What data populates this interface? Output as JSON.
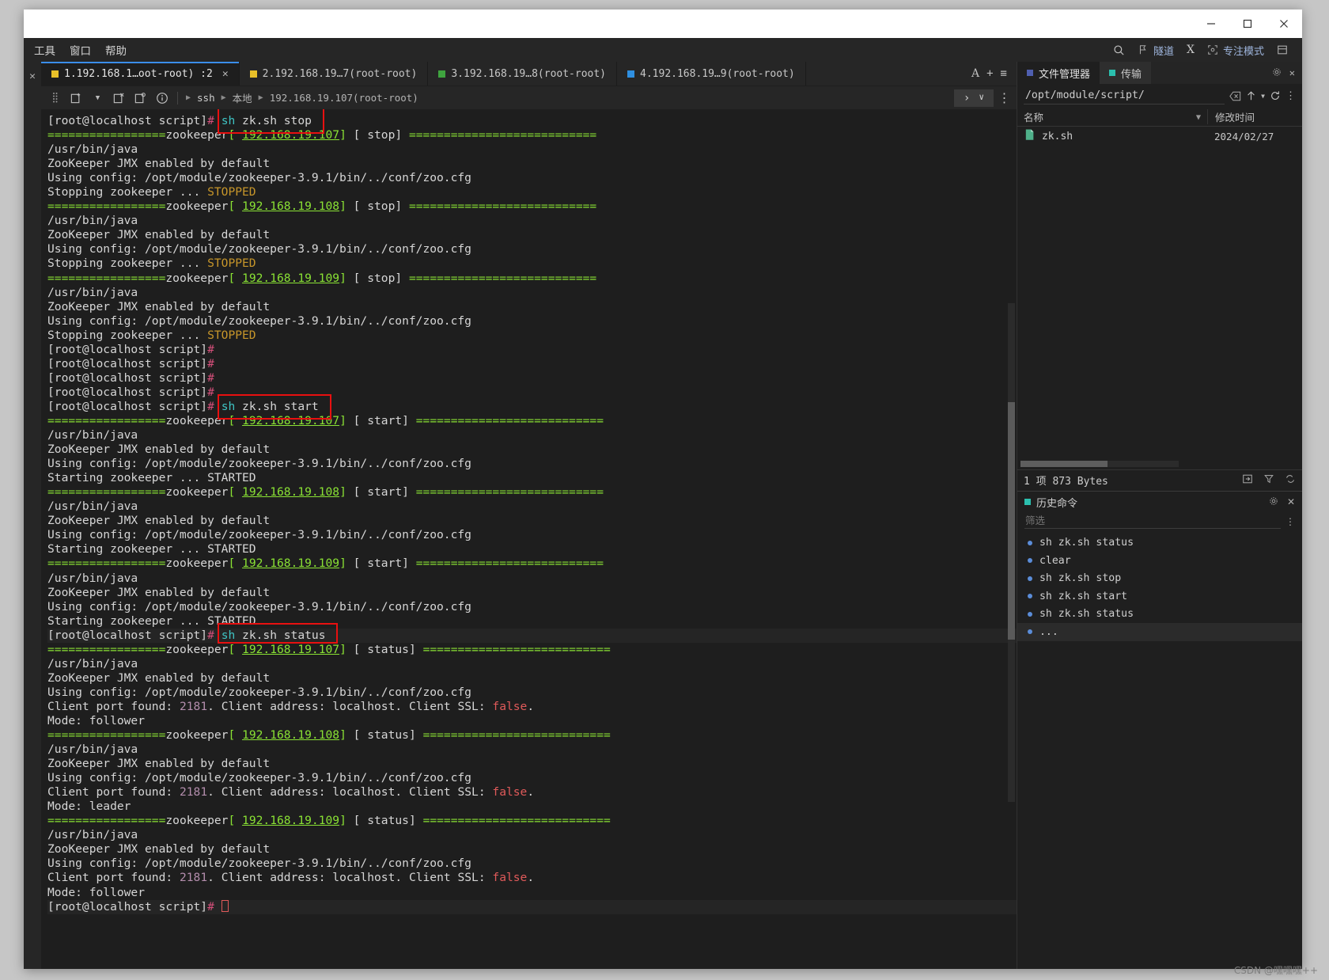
{
  "window": {
    "controls": {
      "minimize": "—",
      "maximize": "❑",
      "close": "✕"
    }
  },
  "menubar": {
    "items": [
      "工具",
      "窗口",
      "帮助"
    ],
    "right": [
      {
        "icon": "search-icon",
        "label": ""
      },
      {
        "icon": "tunnel-icon",
        "label": "隧道"
      },
      {
        "icon": "x-icon",
        "label": "X"
      },
      {
        "icon": "focus-icon",
        "label": "专注模式"
      },
      {
        "icon": "layout-icon",
        "label": ""
      }
    ]
  },
  "tabs": [
    {
      "label": "1.192.168.1…oot-root) :2",
      "color": "#e8c029",
      "active": true,
      "closable": true
    },
    {
      "label": "2.192.168.19…7(root-root)",
      "color": "#e8c029",
      "active": false,
      "closable": false
    },
    {
      "label": "3.192.168.19…8(root-root)",
      "color": "#3fa43f",
      "active": false,
      "closable": false
    },
    {
      "label": "4.192.168.19…9(root-root)",
      "color": "#2f8fe0",
      "active": false,
      "closable": false
    }
  ],
  "tabbar_right": [
    "A",
    "+",
    "≡"
  ],
  "pathbar": {
    "crumbs": [
      "ssh",
      "本地",
      "192.168.19.107(root-root)"
    ],
    "chevron": "›",
    "caret": "∨",
    "more": "⋮"
  },
  "terminal": {
    "prompt": "[root@localhost script]",
    "commands": {
      "stop": "sh zk.sh stop",
      "start": "sh zk.sh start",
      "status": "sh zk.sh status"
    },
    "hosts": [
      "192.168.19.107",
      "192.168.19.108",
      "192.168.19.109"
    ],
    "lines": [
      {
        "t": "prompt-cmd",
        "cmd": "sh zk.sh stop",
        "boxed": true
      },
      {
        "t": "banner",
        "host": "192.168.19.107",
        "action": " stop"
      },
      {
        "t": "plain",
        "s": "/usr/bin/java"
      },
      {
        "t": "plain",
        "s": "ZooKeeper JMX enabled by default"
      },
      {
        "t": "plain",
        "s": "Using config: /opt/module/zookeeper-3.9.1/bin/../conf/zoo.cfg"
      },
      {
        "t": "state",
        "pre": "Stopping zookeeper ... ",
        "word": "STOPPED",
        "cls": "or"
      },
      {
        "t": "banner",
        "host": "192.168.19.108",
        "action": " stop"
      },
      {
        "t": "plain",
        "s": "/usr/bin/java"
      },
      {
        "t": "plain",
        "s": "ZooKeeper JMX enabled by default"
      },
      {
        "t": "plain",
        "s": "Using config: /opt/module/zookeeper-3.9.1/bin/../conf/zoo.cfg"
      },
      {
        "t": "state",
        "pre": "Stopping zookeeper ... ",
        "word": "STOPPED",
        "cls": "or"
      },
      {
        "t": "banner",
        "host": "192.168.19.109",
        "action": " stop"
      },
      {
        "t": "plain",
        "s": "/usr/bin/java"
      },
      {
        "t": "plain",
        "s": "ZooKeeper JMX enabled by default"
      },
      {
        "t": "plain",
        "s": "Using config: /opt/module/zookeeper-3.9.1/bin/../conf/zoo.cfg"
      },
      {
        "t": "state",
        "pre": "Stopping zookeeper ... ",
        "word": "STOPPED",
        "cls": "or"
      },
      {
        "t": "prompt-only"
      },
      {
        "t": "prompt-only"
      },
      {
        "t": "prompt-only"
      },
      {
        "t": "prompt-only"
      },
      {
        "t": "prompt-cmd",
        "cmd": "sh zk.sh start",
        "boxed": true
      },
      {
        "t": "banner",
        "host": "192.168.19.107",
        "action": " start"
      },
      {
        "t": "plain",
        "s": "/usr/bin/java"
      },
      {
        "t": "plain",
        "s": "ZooKeeper JMX enabled by default"
      },
      {
        "t": "plain",
        "s": "Using config: /opt/module/zookeeper-3.9.1/bin/../conf/zoo.cfg"
      },
      {
        "t": "state",
        "pre": "Starting zookeeper ... ",
        "word": "STARTED",
        "cls": "wh"
      },
      {
        "t": "banner",
        "host": "192.168.19.108",
        "action": " start"
      },
      {
        "t": "plain",
        "s": "/usr/bin/java"
      },
      {
        "t": "plain",
        "s": "ZooKeeper JMX enabled by default"
      },
      {
        "t": "plain",
        "s": "Using config: /opt/module/zookeeper-3.9.1/bin/../conf/zoo.cfg"
      },
      {
        "t": "state",
        "pre": "Starting zookeeper ... ",
        "word": "STARTED",
        "cls": "wh"
      },
      {
        "t": "banner",
        "host": "192.168.19.109",
        "action": " start"
      },
      {
        "t": "plain",
        "s": "/usr/bin/java"
      },
      {
        "t": "plain",
        "s": "ZooKeeper JMX enabled by default"
      },
      {
        "t": "plain",
        "s": "Using config: /opt/module/zookeeper-3.9.1/bin/../conf/zoo.cfg"
      },
      {
        "t": "state",
        "pre": "Starting zookeeper ... ",
        "word": "STARTED",
        "cls": "wh"
      },
      {
        "t": "prompt-cmd",
        "cmd": "sh zk.sh status",
        "boxed": true,
        "hl": true
      },
      {
        "t": "banner",
        "host": "192.168.19.107",
        "action": " status"
      },
      {
        "t": "plain",
        "s": "/usr/bin/java"
      },
      {
        "t": "plain",
        "s": "ZooKeeper JMX enabled by default"
      },
      {
        "t": "plain",
        "s": "Using config: /opt/module/zookeeper-3.9.1/bin/../conf/zoo.cfg"
      },
      {
        "t": "clientport",
        "port": "2181",
        "ssl": "false"
      },
      {
        "t": "plain",
        "s": "Mode: follower"
      },
      {
        "t": "banner",
        "host": "192.168.19.108",
        "action": " status"
      },
      {
        "t": "plain",
        "s": "/usr/bin/java"
      },
      {
        "t": "plain",
        "s": "ZooKeeper JMX enabled by default"
      },
      {
        "t": "plain",
        "s": "Using config: /opt/module/zookeeper-3.9.1/bin/../conf/zoo.cfg"
      },
      {
        "t": "clientport",
        "port": "2181",
        "ssl": "false"
      },
      {
        "t": "plain",
        "s": "Mode: leader"
      },
      {
        "t": "banner",
        "host": "192.168.19.109",
        "action": " status"
      },
      {
        "t": "plain",
        "s": "/usr/bin/java"
      },
      {
        "t": "plain",
        "s": "ZooKeeper JMX enabled by default"
      },
      {
        "t": "plain",
        "s": "Using config: /opt/module/zookeeper-3.9.1/bin/../conf/zoo.cfg"
      },
      {
        "t": "clientport",
        "port": "2181",
        "ssl": "false"
      },
      {
        "t": "plain",
        "s": "Mode: follower"
      },
      {
        "t": "prompt-cursor",
        "hl": true
      }
    ]
  },
  "sidebar": {
    "tabs": [
      {
        "label": "文件管理器",
        "color": "#4f5fb0",
        "active": true
      },
      {
        "label": "传输",
        "color": "#2bbfae",
        "active": false
      }
    ],
    "path": "/opt/module/script/",
    "path_placeholder": "/opt/module/script/",
    "columns": [
      "名称",
      "修改时间"
    ],
    "files": [
      {
        "name": "zk.sh",
        "modified": "2024/02/27"
      }
    ],
    "status": "1 项 873 Bytes",
    "history": {
      "title": "历史命令",
      "filter_placeholder": "筛选",
      "filter_value": "",
      "items": [
        {
          "label": "sh zk.sh status",
          "selected": false
        },
        {
          "label": "clear",
          "selected": false
        },
        {
          "label": "sh zk.sh stop",
          "selected": false
        },
        {
          "label": "sh zk.sh start",
          "selected": false
        },
        {
          "label": "sh zk.sh status",
          "selected": false
        },
        {
          "label": "...",
          "selected": true
        }
      ]
    }
  },
  "watermark": "CSDN @嘿嘿嘿++",
  "colors": {
    "accent": "#3b8eea",
    "green": "#6cc24a",
    "orange": "#c7962a",
    "red_box": "#e81010",
    "bullet": "#5b8dd9"
  }
}
